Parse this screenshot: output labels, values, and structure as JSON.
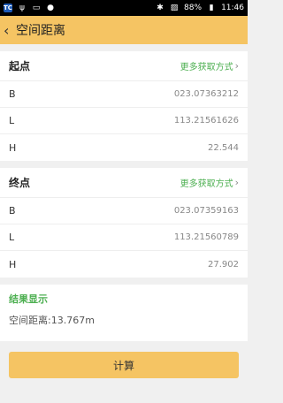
{
  "status_bar": {
    "app_badge": "TC",
    "battery": "88%",
    "time": "11:46"
  },
  "header": {
    "back_icon": "chevron-left",
    "title": "空间距离"
  },
  "start": {
    "title": "起点",
    "more_label": "更多获取方式",
    "rows": [
      {
        "label": "B",
        "value": "023.07363212"
      },
      {
        "label": "L",
        "value": "113.21561626"
      },
      {
        "label": "H",
        "value": "22.544"
      }
    ]
  },
  "end": {
    "title": "终点",
    "more_label": "更多获取方式",
    "rows": [
      {
        "label": "B",
        "value": "023.07359163"
      },
      {
        "label": "L",
        "value": "113.21560789"
      },
      {
        "label": "H",
        "value": "27.902"
      }
    ]
  },
  "result": {
    "title": "结果显示",
    "text": "空间距离:13.767m"
  },
  "action": {
    "calc_label": "计算"
  },
  "colors": {
    "accent": "#f5c463",
    "green": "#4caf50"
  }
}
